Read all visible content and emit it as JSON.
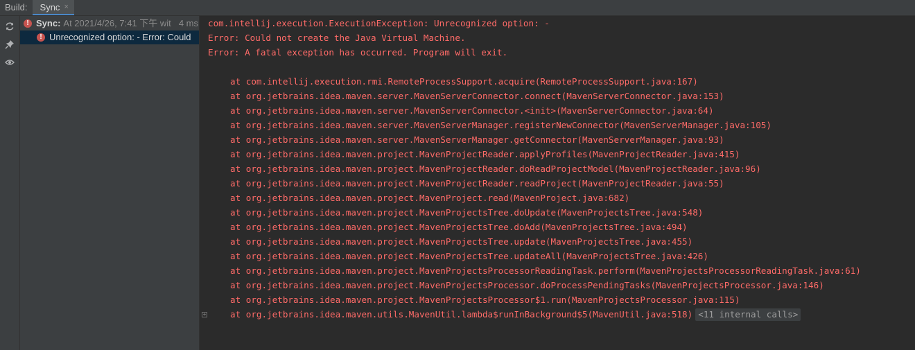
{
  "tabbar": {
    "build_label": "Build:",
    "active_tab": "Sync",
    "close_glyph": "×"
  },
  "toolstrip": {
    "icons": [
      "refresh-icon",
      "pin-icon",
      "eye-icon"
    ]
  },
  "tree": {
    "root": {
      "title": "Sync:",
      "detail": "At 2021/4/26, 7:41 下午 wit",
      "duration": "4 ms"
    },
    "child": {
      "label": "Unrecognized option: - Error: Could"
    }
  },
  "console": {
    "header_lines": [
      "com.intellij.execution.ExecutionException: Unrecognized option: -",
      "Error: Could not create the Java Virtual Machine.",
      "Error: A fatal exception has occurred. Program will exit."
    ],
    "stack_lines": [
      "at com.intellij.execution.rmi.RemoteProcessSupport.acquire(RemoteProcessSupport.java:167)",
      "at org.jetbrains.idea.maven.server.MavenServerConnector.connect(MavenServerConnector.java:153)",
      "at org.jetbrains.idea.maven.server.MavenServerConnector.<init>(MavenServerConnector.java:64)",
      "at org.jetbrains.idea.maven.server.MavenServerManager.registerNewConnector(MavenServerManager.java:105)",
      "at org.jetbrains.idea.maven.server.MavenServerManager.getConnector(MavenServerManager.java:93)",
      "at org.jetbrains.idea.maven.project.MavenProjectReader.applyProfiles(MavenProjectReader.java:415)",
      "at org.jetbrains.idea.maven.project.MavenProjectReader.doReadProjectModel(MavenProjectReader.java:96)",
      "at org.jetbrains.idea.maven.project.MavenProjectReader.readProject(MavenProjectReader.java:55)",
      "at org.jetbrains.idea.maven.project.MavenProject.read(MavenProject.java:682)",
      "at org.jetbrains.idea.maven.project.MavenProjectsTree.doUpdate(MavenProjectsTree.java:548)",
      "at org.jetbrains.idea.maven.project.MavenProjectsTree.doAdd(MavenProjectsTree.java:494)",
      "at org.jetbrains.idea.maven.project.MavenProjectsTree.update(MavenProjectsTree.java:455)",
      "at org.jetbrains.idea.maven.project.MavenProjectsTree.updateAll(MavenProjectsTree.java:426)",
      "at org.jetbrains.idea.maven.project.MavenProjectsProcessorReadingTask.perform(MavenProjectsProcessorReadingTask.java:61)",
      "at org.jetbrains.idea.maven.project.MavenProjectsProcessor.doProcessPendingTasks(MavenProjectsProcessor.java:146)",
      "at org.jetbrains.idea.maven.project.MavenProjectsProcessor$1.run(MavenProjectsProcessor.java:115)",
      "at org.jetbrains.idea.maven.utils.MavenUtil.lambda$runInBackground$5(MavenUtil.java:518)"
    ],
    "internal_calls": "<11 internal calls>",
    "fold_glyph": "+"
  },
  "colors": {
    "error_text": "#ff6b68",
    "error_icon": "#c75450",
    "selection": "#0d293e",
    "panel_bg": "#3c3f41",
    "console_bg": "#2b2b2b"
  }
}
